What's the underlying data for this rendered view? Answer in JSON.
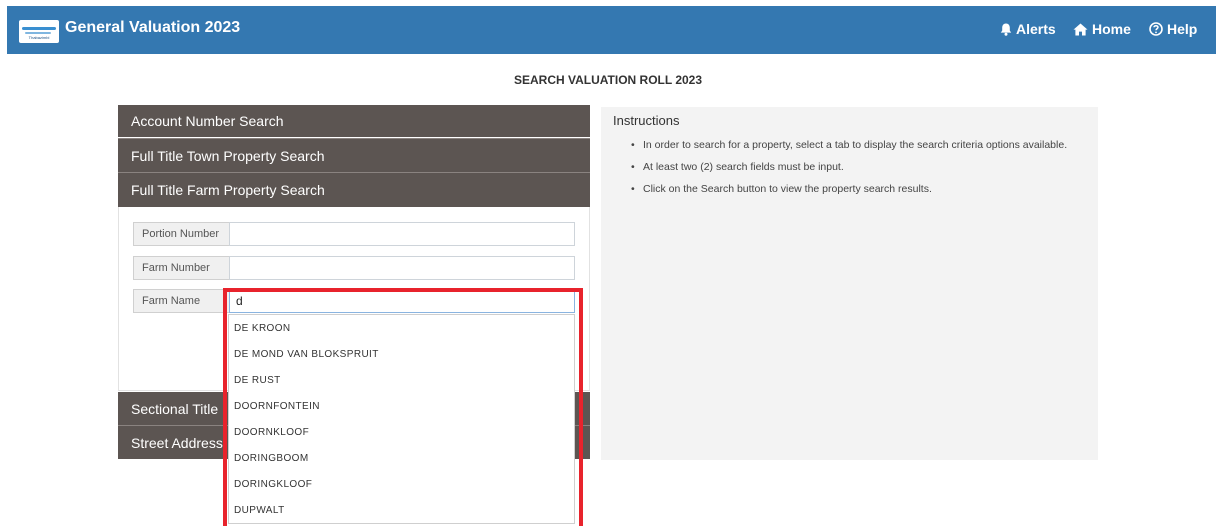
{
  "header": {
    "title": "General Valuation 2023",
    "logo_text": "Thabazimbi",
    "nav": {
      "alerts": "Alerts",
      "home": "Home",
      "help": "Help"
    }
  },
  "page_heading": "SEARCH VALUATION ROLL 2023",
  "accordion": {
    "account_number": "Account Number Search",
    "town_property": "Full Title Town Property Search",
    "farm_property": "Full Title Farm Property Search",
    "sectional_title": "Sectional Title",
    "street_address": "Street Address"
  },
  "farm_search": {
    "portion_number_label": "Portion Number",
    "portion_number_value": "",
    "farm_number_label": "Farm Number",
    "farm_number_value": "",
    "farm_name_label": "Farm Name",
    "farm_name_value": "d"
  },
  "autocomplete": {
    "items": [
      "DE KROON",
      "DE MOND VAN BLOKSPRUIT",
      "DE RUST",
      "DOORNFONTEIN",
      "DOORNKLOOF",
      "DORINGBOOM",
      "DORINGKLOOF",
      "DUPWALT"
    ]
  },
  "instructions": {
    "title": "Instructions",
    "items": [
      "In order to search for a property, select a tab to display the search criteria options available.",
      "At least two (2) search fields must be input.",
      "Click on the Search button to view the property search results."
    ]
  },
  "colors": {
    "header": "#3478b1",
    "accordion": "#5c5552",
    "highlight": "#e8232c"
  }
}
